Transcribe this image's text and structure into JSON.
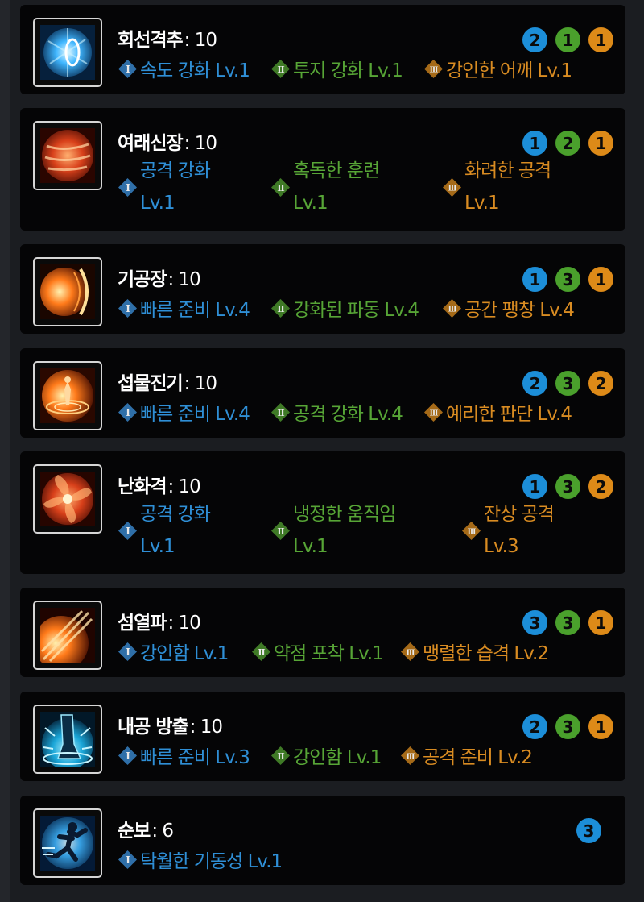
{
  "skills": [
    {
      "name": "회선격추",
      "level": ": 10",
      "badges": [
        "2",
        "1",
        "1"
      ],
      "icon": "spinning-blast-icon",
      "tripods": [
        {
          "label": "속도 강화 Lv.1"
        },
        {
          "label": "투지 강화 Lv.1"
        },
        {
          "label": "강인한 어깨 Lv.1"
        }
      ]
    },
    {
      "name": "여래신장",
      "level": ": 10",
      "badges": [
        "1",
        "2",
        "1"
      ],
      "icon": "palm-strike-icon",
      "tripods": [
        {
          "line1": "공격 강화",
          "line2": "Lv.1"
        },
        {
          "line1": "혹독한 훈련",
          "line2": "Lv.1"
        },
        {
          "line1": "화려한 공격",
          "line2": "Lv.1"
        }
      ]
    },
    {
      "name": "기공장",
      "level": ": 10",
      "badges": [
        "1",
        "3",
        "1"
      ],
      "icon": "energy-palm-icon",
      "tripods": [
        {
          "label": "빠른 준비 Lv.4"
        },
        {
          "label": "강화된 파동 Lv.4"
        },
        {
          "label": "공간 팽창 Lv.4"
        }
      ]
    },
    {
      "name": "섭물진기",
      "level": ": 10",
      "badges": [
        "2",
        "3",
        "2"
      ],
      "icon": "energy-circle-icon",
      "tripods": [
        {
          "label": "빠른 준비 Lv.4"
        },
        {
          "label": "공격 강화 Lv.4"
        },
        {
          "label": "예리한 판단 Lv.4"
        }
      ]
    },
    {
      "name": "난화격",
      "level": ": 10",
      "badges": [
        "1",
        "3",
        "2"
      ],
      "icon": "flower-strike-icon",
      "tripods": [
        {
          "line1": "공격 강화",
          "line2": "Lv.1"
        },
        {
          "line1": "냉정한 움직임",
          "line2": "Lv.1"
        },
        {
          "line1": "잔상 공격",
          "line2": "Lv.3"
        }
      ]
    },
    {
      "name": "섬열파",
      "level": ": 10",
      "badges": [
        "3",
        "3",
        "1"
      ],
      "icon": "flash-wave-icon",
      "tripods": [
        {
          "label": "강인함 Lv.1"
        },
        {
          "label": "약점 포착 Lv.1"
        },
        {
          "label": "맹렬한 습격 Lv.2"
        }
      ]
    },
    {
      "name": "내공 방출",
      "level": ": 10",
      "badges": [
        "2",
        "3",
        "1"
      ],
      "icon": "inner-force-icon",
      "tripods": [
        {
          "label": "빠른 준비 Lv.3"
        },
        {
          "label": "강인함 Lv.1"
        },
        {
          "label": "공격 준비 Lv.2"
        }
      ]
    },
    {
      "name": "순보",
      "level": ": 6",
      "badges": [
        "3"
      ],
      "icon": "dash-step-icon",
      "tripods": [
        {
          "label": "탁월한 기동성 Lv.1"
        }
      ]
    }
  ],
  "colors": {
    "tier1": "#2f8fd6",
    "tier2": "#57a536",
    "tier3": "#d98c22",
    "row_bg": "#050506",
    "page_bg": "#1b1d21"
  }
}
